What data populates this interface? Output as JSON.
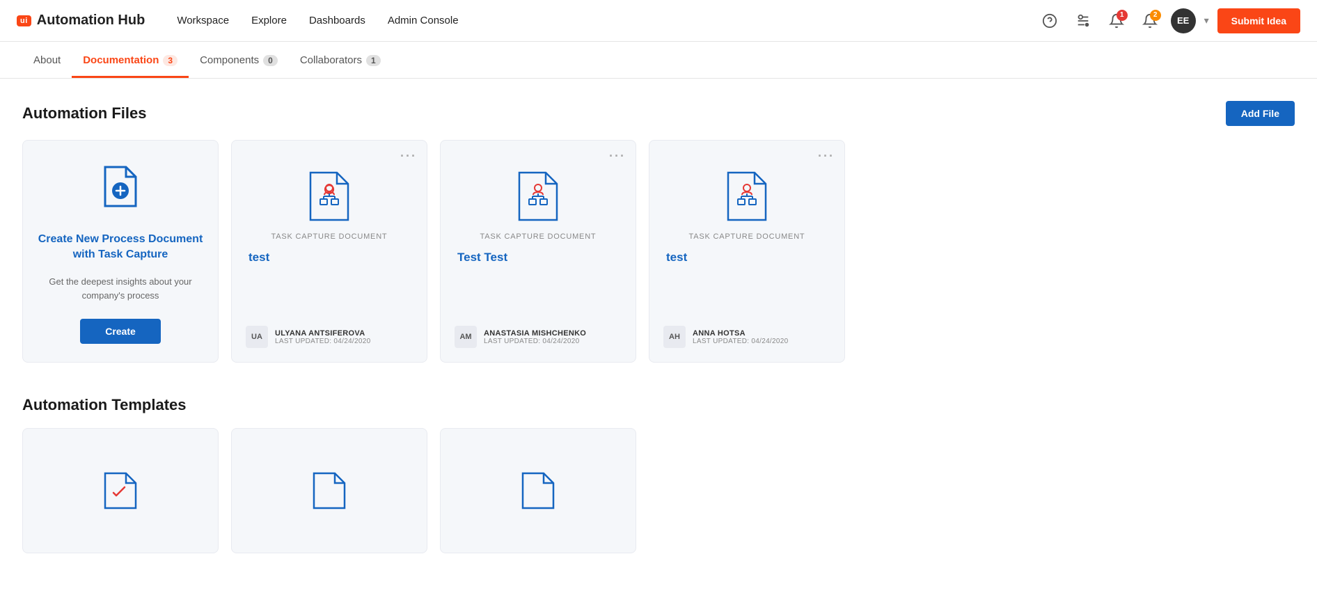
{
  "header": {
    "logo_badge": "ui",
    "logo_text": "Automation Hub",
    "nav": [
      "Workspace",
      "Explore",
      "Dashboards",
      "Admin Console"
    ],
    "help_icon": "?",
    "filter_icon": "≡",
    "notification_badge_1": "1",
    "notification_badge_2": "2",
    "avatar_initials": "EE",
    "submit_btn": "Submit Idea"
  },
  "tabs": [
    {
      "label": "About",
      "badge": null,
      "active": false
    },
    {
      "label": "Documentation",
      "badge": "3",
      "active": true
    },
    {
      "label": "Components",
      "badge": "0",
      "active": false
    },
    {
      "label": "Collaborators",
      "badge": "1",
      "active": false
    }
  ],
  "automation_files": {
    "section_title": "Automation Files",
    "add_btn": "Add File",
    "create_card": {
      "title": "Create New Process Document with Task Capture",
      "description": "Get the deepest insights about your company's process",
      "btn": "Create"
    },
    "documents": [
      {
        "type_label": "TASK CAPTURE DOCUMENT",
        "title": "test",
        "user_initials": "UA",
        "user_name": "ULYANA ANTSIFEROVA",
        "last_updated": "LAST UPDATED: 04/24/2020"
      },
      {
        "type_label": "TASK CAPTURE DOCUMENT",
        "title": "Test Test",
        "user_initials": "AM",
        "user_name": "ANASTASIA MISHCHENKO",
        "last_updated": "LAST UPDATED: 04/24/2020"
      },
      {
        "type_label": "TASK CAPTURE DOCUMENT",
        "title": "test",
        "user_initials": "AH",
        "user_name": "ANNA HOTSA",
        "last_updated": "LAST UPDATED: 04/24/2020"
      }
    ]
  },
  "automation_templates": {
    "section_title": "Automation Templates"
  }
}
